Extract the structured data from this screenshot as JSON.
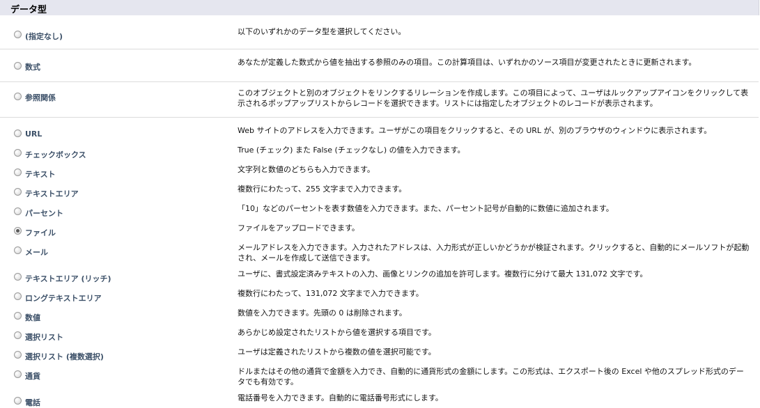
{
  "header": {
    "title": "データ型"
  },
  "options": [
    {
      "label": "(指定なし)",
      "description": "以下のいずれかのデータ型を選択してください。",
      "checked": false
    },
    {
      "label": "数式",
      "description": "あなたが定義した数式から値を抽出する参照のみの項目。この計算項目は、いずれかのソース項目が変更されたときに更新されます。",
      "checked": false
    },
    {
      "label": "参照関係",
      "description": "このオブジェクトと別のオブジェクトをリンクするリレーションを作成します。この項目によって、ユーザはルックアップアイコンをクリックして表示されるポップアップリストからレコードを選択できます。リストには指定したオブジェクトのレコードが表示されます。",
      "checked": false
    },
    {
      "label": "URL",
      "description": "Web サイトのアドレスを入力できます。ユーザがこの項目をクリックすると、その URL が、別のブラウザのウィンドウに表示されます。",
      "checked": false
    },
    {
      "label": "チェックボックス",
      "description": "True (チェック) また False (チェックなし) の値を入力できます。",
      "checked": false
    },
    {
      "label": "テキスト",
      "description": "文字列と数値のどちらも入力できます。",
      "checked": false
    },
    {
      "label": "テキストエリア",
      "description": "複数行にわたって、255 文字まで入力できます。",
      "checked": false
    },
    {
      "label": "パーセント",
      "description": "「10」などのパーセントを表す数値を入力できます。また、パーセント記号が自動的に数値に追加されます。",
      "checked": false
    },
    {
      "label": "ファイル",
      "description": "ファイルをアップロードできます。",
      "checked": true
    },
    {
      "label": "メール",
      "description": "メールアドレスを入力できます。入力されたアドレスは、入力形式が正しいかどうかが検証されます。クリックすると、自動的にメールソフトが起動され、メールを作成して送信できます。",
      "checked": false
    },
    {
      "label": "テキストエリア (リッチ)",
      "description": "ユーザに、書式設定済みテキストの入力、画像とリンクの追加を許可します。複数行に分けて最大 131,072 文字です。",
      "checked": false
    },
    {
      "label": "ロングテキストエリア",
      "description": "複数行にわたって、131,072 文字まで入力できます。",
      "checked": false
    },
    {
      "label": "数値",
      "description": "数値を入力できます。先頭の 0 は削除されます。",
      "checked": false
    },
    {
      "label": "選択リスト",
      "description": "あらかじめ設定されたリストから値を選択する項目です。",
      "checked": false
    },
    {
      "label": "選択リスト (複数選択)",
      "description": "ユーザは定義されたリストから複数の値を選択可能です。",
      "checked": false
    },
    {
      "label": "通貨",
      "description": "ドルまたはその他の通貨で金額を入力でき、自動的に通貨形式の金額にします。この形式は、エクスポート後の Excel や他のスプレッド形式のデータでも有効です。",
      "checked": false
    },
    {
      "label": "電話",
      "description": "電話番号を入力できます。自動的に電話番号形式にします。",
      "checked": false
    }
  ]
}
